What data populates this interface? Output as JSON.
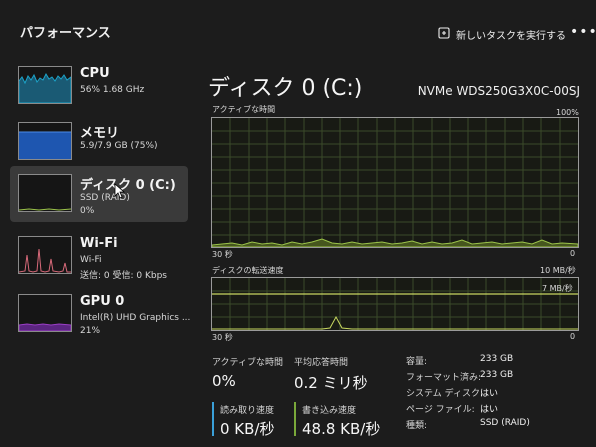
{
  "header": {
    "title": "パフォーマンス",
    "run_task_label": "新しいタスクを実行する",
    "more_label": "•••"
  },
  "sidebar": {
    "items": [
      {
        "title": "CPU",
        "line1": "56%  1.68 GHz",
        "line2": "",
        "color": "#1ca3c9",
        "selected": false
      },
      {
        "title": "メモリ",
        "line1": "5.9/7.9 GB (75%)",
        "line2": "",
        "color": "#2a6fd6",
        "selected": false
      },
      {
        "title": "ディスク 0 (C:)",
        "line1": "SSD (RAID)",
        "line2": "0%",
        "color": "#9cc44a",
        "selected": true
      },
      {
        "title": "Wi-Fi",
        "line1": "Wi-Fi",
        "line2": "送信: 0  受信: 0 Kbps",
        "color": "#d86a7a",
        "selected": false
      },
      {
        "title": "GPU 0",
        "line1": "Intel(R) UHD Graphics ...",
        "line2": "21%",
        "color": "#9b3fc6",
        "selected": false
      }
    ]
  },
  "main": {
    "title": "ディスク 0 (C:)",
    "model": "NVMe WDS250G3X0C-00SJ",
    "active_time_graph": {
      "label": "アクティブな時間",
      "max_label": "100%",
      "time_label": "30 秒",
      "min_label": "0"
    },
    "transfer_graph": {
      "label": "ディスクの転送速度",
      "max_label": "10 MB/秒",
      "ref_label": "7 MB/秒",
      "time_label": "30 秒",
      "min_label": "0"
    },
    "stats": {
      "active_time_label": "アクティブな時間",
      "active_time_value": "0%",
      "avg_response_label": "平均応答時間",
      "avg_response_value": "0.2 ミリ秒",
      "read_speed_label": "読み取り速度",
      "read_speed_value": "0 KB/秒",
      "write_speed_label": "書き込み速度",
      "write_speed_value": "48.8 KB/秒"
    },
    "properties": [
      {
        "label": "容量:",
        "value": "233 GB"
      },
      {
        "label": "フォーマット済み:",
        "value": "233 GB"
      },
      {
        "label": "システム ディスク:",
        "value": "はい"
      },
      {
        "label": "ページ ファイル:",
        "value": "はい"
      },
      {
        "label": "種類:",
        "value": "SSD (RAID)"
      }
    ]
  },
  "colors": {
    "disk_accent": "#9cc44a",
    "read_bar": "#3aa0d8",
    "write_bar": "#7aa83a"
  }
}
